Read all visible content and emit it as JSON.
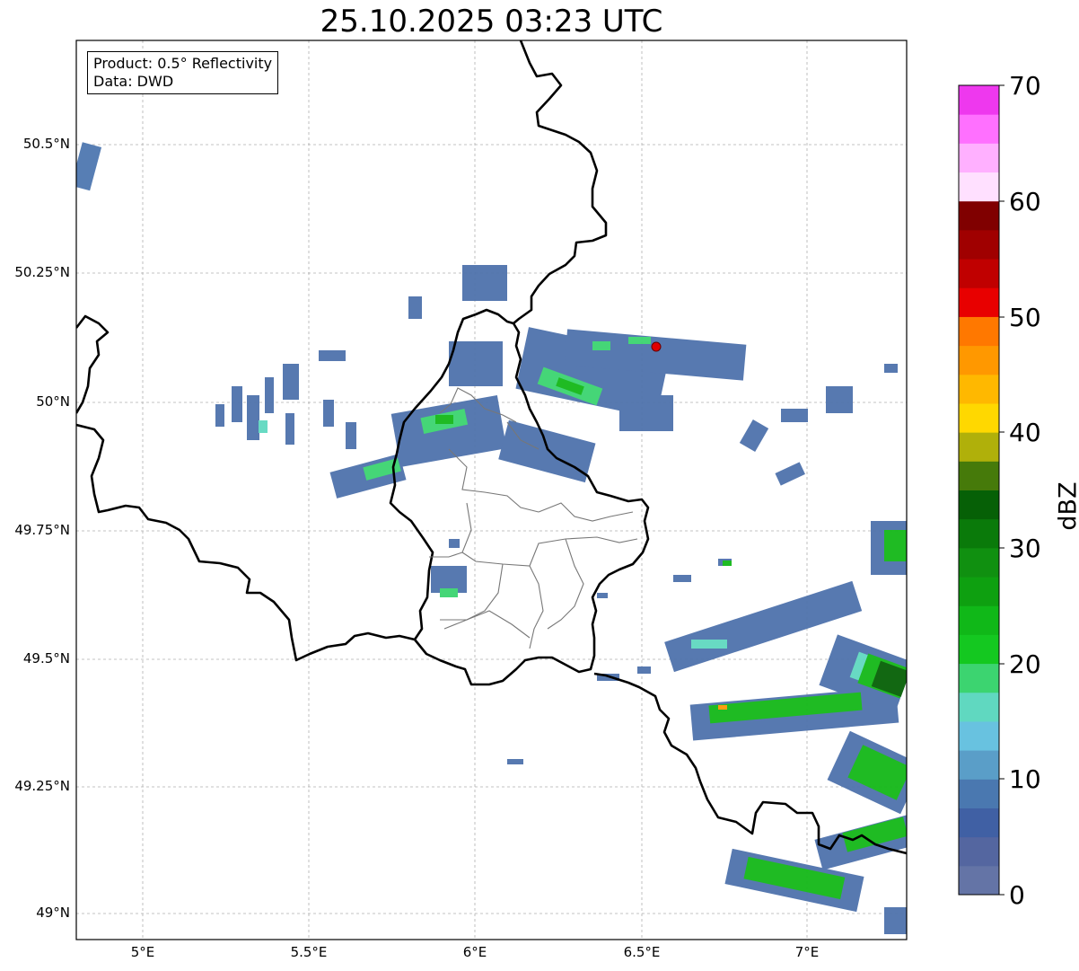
{
  "title": "25.10.2025 03:23 UTC",
  "info": {
    "product": "Product: 0.5° Reflectivity",
    "data": "Data: DWD"
  },
  "lat_labels": [
    "50.5°N",
    "50.25°N",
    "50°N",
    "49.75°N",
    "49.5°N",
    "49.25°N",
    "49°N"
  ],
  "lon_labels": [
    "5°E",
    "5.5°E",
    "6°E",
    "6.5°E",
    "7°E"
  ],
  "colorbar": {
    "unit": "dBZ",
    "ticks": [
      "0",
      "10",
      "20",
      "30",
      "40",
      "50",
      "60",
      "70"
    ],
    "colors": [
      "#6474a6",
      "#5466a0",
      "#4060a4",
      "#4a78b0",
      "#5a9ec8",
      "#68c2e0",
      "#60d8c0",
      "#3cd470",
      "#14c820",
      "#10b818",
      "#0ea010",
      "#109010",
      "#0a7a0a",
      "#066006",
      "#467a0a",
      "#b0b00a",
      "#ffd800",
      "#ffb800",
      "#ff9800",
      "#ff7800",
      "#e80000",
      "#c00000",
      "#a00000",
      "#800000",
      "#ffe0ff",
      "#ffb0ff",
      "#ff70ff",
      "#ee38ee"
    ]
  },
  "marker": {
    "label": "radar-site",
    "color": "#e00000"
  }
}
